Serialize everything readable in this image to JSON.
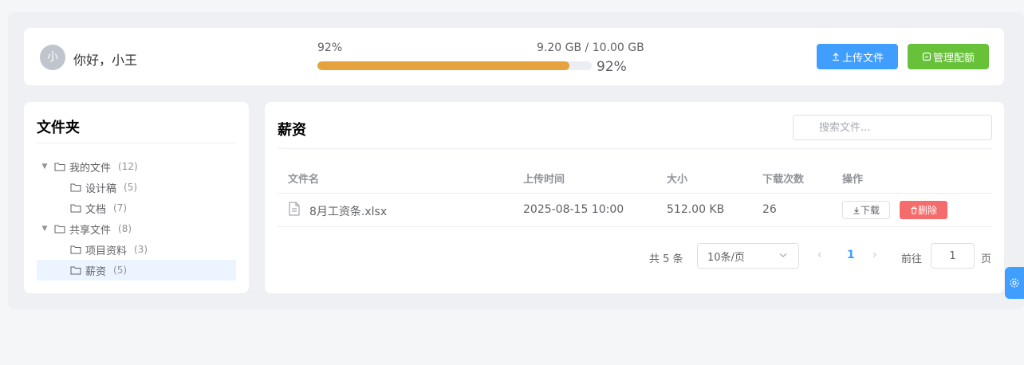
{
  "header": {
    "avatar_text": "小",
    "greeting": "你好，小王",
    "storage": {
      "percent_text": "92%",
      "size_text": "9.20 GB / 10.00 GB",
      "bar_label": "92%",
      "used_fraction": 0.92
    },
    "upload_button": "上传文件",
    "quota_button": "管理配额"
  },
  "sidebar": {
    "title": "文件夹",
    "tree": [
      {
        "label": "我的文件",
        "count": "(12)",
        "expanded": true
      },
      {
        "label": "设计稿",
        "count": "(5)"
      },
      {
        "label": "文档",
        "count": "(7)"
      },
      {
        "label": "共享文件",
        "count": "(8)",
        "expanded": true
      },
      {
        "label": "项目资料",
        "count": "(3)"
      },
      {
        "label": "薪资",
        "count": "(5)",
        "selected": true
      }
    ]
  },
  "main": {
    "title": "薪资",
    "search_placeholder": "搜索文件...",
    "columns": [
      "文件名",
      "上传时间",
      "大小",
      "下载次数",
      "操作"
    ],
    "rows": [
      {
        "name": "8月工资条.xlsx",
        "uploaded": "2025-08-15 10:00",
        "size": "512.00 KB",
        "downloads": "26",
        "download_label": "下载",
        "delete_label": "删除"
      }
    ],
    "pagination": {
      "total_text": "共 5 条",
      "page_size": "10条/页",
      "current_page": "1",
      "goto_label": "前往",
      "goto_value": "1",
      "goto_unit": "页"
    }
  },
  "colors": {
    "primary": "#409eff",
    "success": "#67c23a",
    "warning": "#e6a23c",
    "danger": "#f56c6c"
  },
  "icons": {
    "upload": "upload-icon",
    "quota": "quota-icon",
    "folder": "folder-icon",
    "file": "file-icon",
    "download": "download-icon",
    "delete": "trash-icon",
    "search": "search-icon",
    "settings": "gear-icon"
  }
}
